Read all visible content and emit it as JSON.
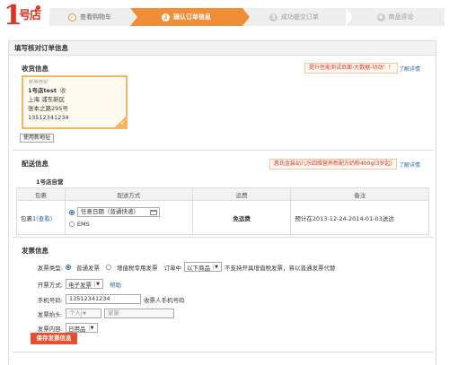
{
  "logo": {
    "one": "1",
    "chars": "号店"
  },
  "steps": [
    {
      "num": "✓",
      "label": "查看购物车"
    },
    {
      "num": "2",
      "label": "确认订单信息"
    },
    {
      "num": "3",
      "label": "成功提交订单"
    },
    {
      "num": "4",
      "label": "商品评论"
    }
  ],
  "page_title": "填写核对订单信息",
  "shipping_info": {
    "title": "收货信息",
    "promo": "提升性能测试页面-大数据-功动！！",
    "promo_link": "了解详情",
    "address": {
      "default_tag": "常用地址",
      "name": "1号店test",
      "edit": "收",
      "line1": "上海 浦东新区",
      "line2": "张本之路295号",
      "phone": "13512341234"
    },
    "new_address_button": "使用新地址"
  },
  "delivery": {
    "title": "配送信息",
    "promo": "惠氏金装幼儿乐四维营养新配方奶粉400g(3岁起)",
    "promo_link": "了解详情",
    "store": "1号店自营",
    "headers": [
      "包裹",
      "配送方式",
      "运费",
      "备注"
    ],
    "row": {
      "package": "包裹1",
      "view": "(查看)",
      "option1": "任意日期（普通快递）",
      "option2": "EMS",
      "fee": "免运费",
      "note": "预计在2013-12-24-2014-01-03送达"
    }
  },
  "invoice": {
    "title": "发票信息",
    "type_label": "发票类型:",
    "type_normal": "普通发票",
    "type_vat": "增值税专用发票",
    "type_note1": "订单中",
    "type_select": "以下商品",
    "type_note2": "不支持开具增值税发票，将以普通发票代替",
    "method_label": "开票方式:",
    "method_value": "电子发票",
    "method_help": "帮助",
    "phone_label": "手机号码:",
    "phone_value": "13512341234",
    "phone_note": "收票人手机号码",
    "header_label": "发票抬头:",
    "header_select": "个人",
    "header_placeholder": "家家",
    "content_label": "发票内容:",
    "content_value": "日用品",
    "save_button": "保存发票信息"
  }
}
